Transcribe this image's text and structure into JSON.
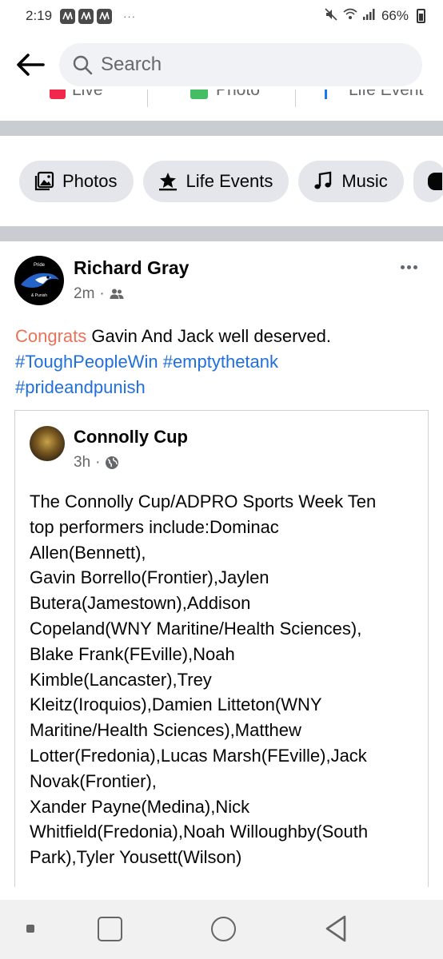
{
  "status_bar": {
    "time": "2:19",
    "dots": "···",
    "battery": "66%"
  },
  "search": {
    "placeholder": "Search"
  },
  "action_row": [
    {
      "label": "Live"
    },
    {
      "label": "Photo"
    },
    {
      "label": "Life Event"
    }
  ],
  "chips": [
    {
      "label": "Photos",
      "icon": "photo-icon"
    },
    {
      "label": "Life Events",
      "icon": "star-flag-icon"
    },
    {
      "label": "Music",
      "icon": "music-note-icon"
    }
  ],
  "post": {
    "avatar_text_top": "Pride",
    "avatar_text_bottom": "& Punish",
    "author": "Richard Gray",
    "time": "2m",
    "audience_icon": "friends-icon",
    "text": {
      "congrats": "Congrats",
      "rest": " Gavin And Jack well deserved.",
      "hashtags": [
        "#ToughPeopleWin",
        "#emptythetank",
        "#prideandpunish"
      ]
    },
    "shared": {
      "author": "Connolly Cup",
      "time": "3h",
      "audience_icon": "globe-icon",
      "lines": [
        "The Connolly Cup/ADPRO Sports Week Ten",
        "top performers include:Dominac",
        "Allen(Bennett),",
        "Gavin Borrello(Frontier),Jaylen",
        "Butera(Jamestown),Addison",
        "Copeland(WNY Maritine/Health Sciences),",
        "Blake Frank(FEville),Noah",
        "Kimble(Lancaster),Trey",
        "Kleitz(Iroquios),Damien Litteton(WNY",
        "Maritine/Health Sciences),Matthew",
        "Lotter(Fredonia),Lucas Marsh(FEville),Jack",
        "Novak(Frontier),",
        "Xander Payne(Medina),Nick",
        "Whitfield(Fredonia),Noah Willoughby(South",
        "Park),Tyler Yousett(Wilson)"
      ]
    }
  },
  "colors": {
    "accent_blue": "#216fdb",
    "congrats": "#e8735a",
    "chip_bg": "#e4e6eb",
    "divider": "#c9ccd1"
  }
}
